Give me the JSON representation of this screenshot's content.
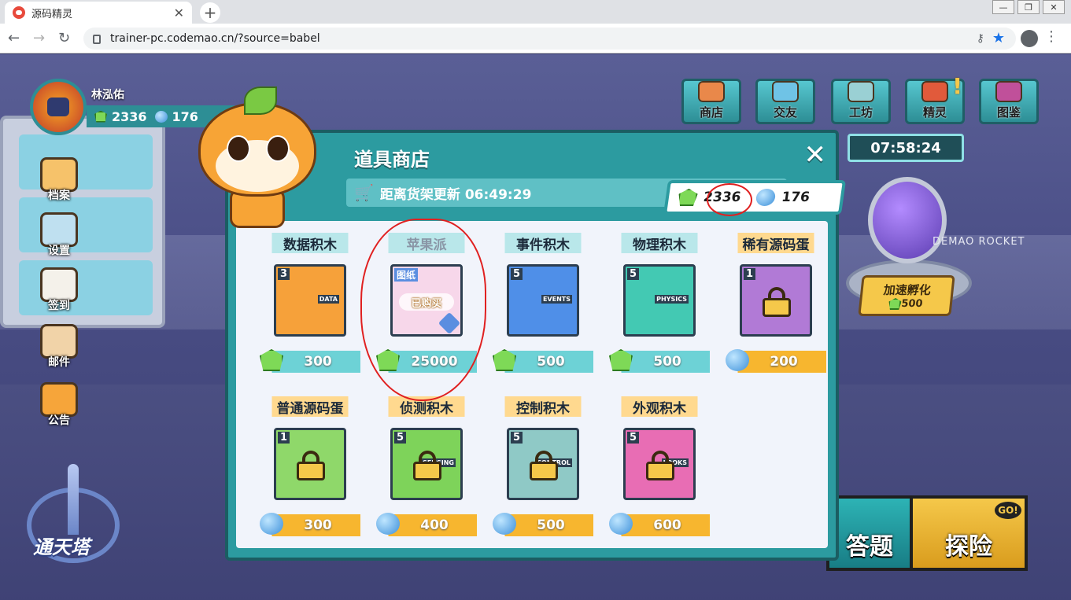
{
  "browser": {
    "tab_title": "源码精灵",
    "url": "trainer-pc.codemao.cn/?source=babel"
  },
  "player": {
    "name": "林泓佑",
    "gems": "2336",
    "orbs": "176"
  },
  "side_menu": [
    {
      "label": "档案",
      "icon": "file-icon",
      "color": "#f6c26a"
    },
    {
      "label": "设置",
      "icon": "settings-icon",
      "color": "#bfe0f0"
    },
    {
      "label": "签到",
      "icon": "calendar-icon",
      "color": "#f4f1ea"
    },
    {
      "label": "邮件",
      "icon": "mail-icon",
      "color": "#f1d3a8"
    },
    {
      "label": "公告",
      "icon": "megaphone-icon",
      "color": "#f6a53a"
    }
  ],
  "tower": {
    "label": "通天塔"
  },
  "top_nav": [
    {
      "label": "商店",
      "icon": "store-icon",
      "color": "#e9884a"
    },
    {
      "label": "交友",
      "icon": "chat-icon",
      "color": "#6fc3e6"
    },
    {
      "label": "工坊",
      "icon": "tools-icon",
      "color": "#9ad0d4"
    },
    {
      "label": "精灵",
      "icon": "sprite-icon",
      "color": "#e15a3b",
      "alert": "!"
    },
    {
      "label": "图鉴",
      "icon": "book-icon",
      "color": "#c0509a"
    }
  ],
  "rocket": {
    "timer": "07:58:24",
    "brand_text": "DEMAO ROCKET",
    "speedup_label": "加速孵化",
    "speedup_cost": "500"
  },
  "shop": {
    "title": "道具商店",
    "refresh_text": "距离货架更新 06:49:29",
    "gems": "2336",
    "orbs": "176",
    "items": [
      {
        "name": "数据积木",
        "count": "3",
        "price": "300",
        "currency": "gem",
        "theme": "teal",
        "img": "#f6a13a",
        "logo": "DATA",
        "locked": false
      },
      {
        "name": "苹果派",
        "count": "",
        "price": "25000",
        "currency": "gem",
        "theme": "teal",
        "img": "#f7d7ea",
        "logo": "",
        "locked": false,
        "tag": "图纸",
        "status": "已购买",
        "dim": true
      },
      {
        "name": "事件积木",
        "count": "5",
        "price": "500",
        "currency": "gem",
        "theme": "teal",
        "img": "#4f8fe8",
        "logo": "EVENTS",
        "locked": false
      },
      {
        "name": "物理积木",
        "count": "5",
        "price": "500",
        "currency": "gem",
        "theme": "teal",
        "img": "#43c9b3",
        "logo": "PHYSICS",
        "locked": false
      },
      {
        "name": "稀有源码蛋",
        "count": "1",
        "price": "200",
        "currency": "orb",
        "theme": "gold",
        "img": "#b17ad6",
        "logo": "",
        "locked": true
      },
      {
        "name": "普通源码蛋",
        "count": "1",
        "price": "300",
        "currency": "orb",
        "theme": "gold",
        "img": "#8fd86a",
        "logo": "",
        "locked": true
      },
      {
        "name": "侦测积木",
        "count": "5",
        "price": "400",
        "currency": "orb",
        "theme": "gold",
        "img": "#7ed35a",
        "logo": "SENSING",
        "locked": true
      },
      {
        "name": "控制积木",
        "count": "5",
        "price": "500",
        "currency": "orb",
        "theme": "gold",
        "img": "#8fc9c6",
        "logo": "CONTROL",
        "locked": true
      },
      {
        "name": "外观积木",
        "count": "5",
        "price": "600",
        "currency": "orb",
        "theme": "gold",
        "img": "#e86db4",
        "logo": "LOOKS",
        "locked": true
      }
    ]
  },
  "actions": {
    "answer_label": "答题",
    "explore_label": "探险",
    "go_badge": "GO!"
  }
}
